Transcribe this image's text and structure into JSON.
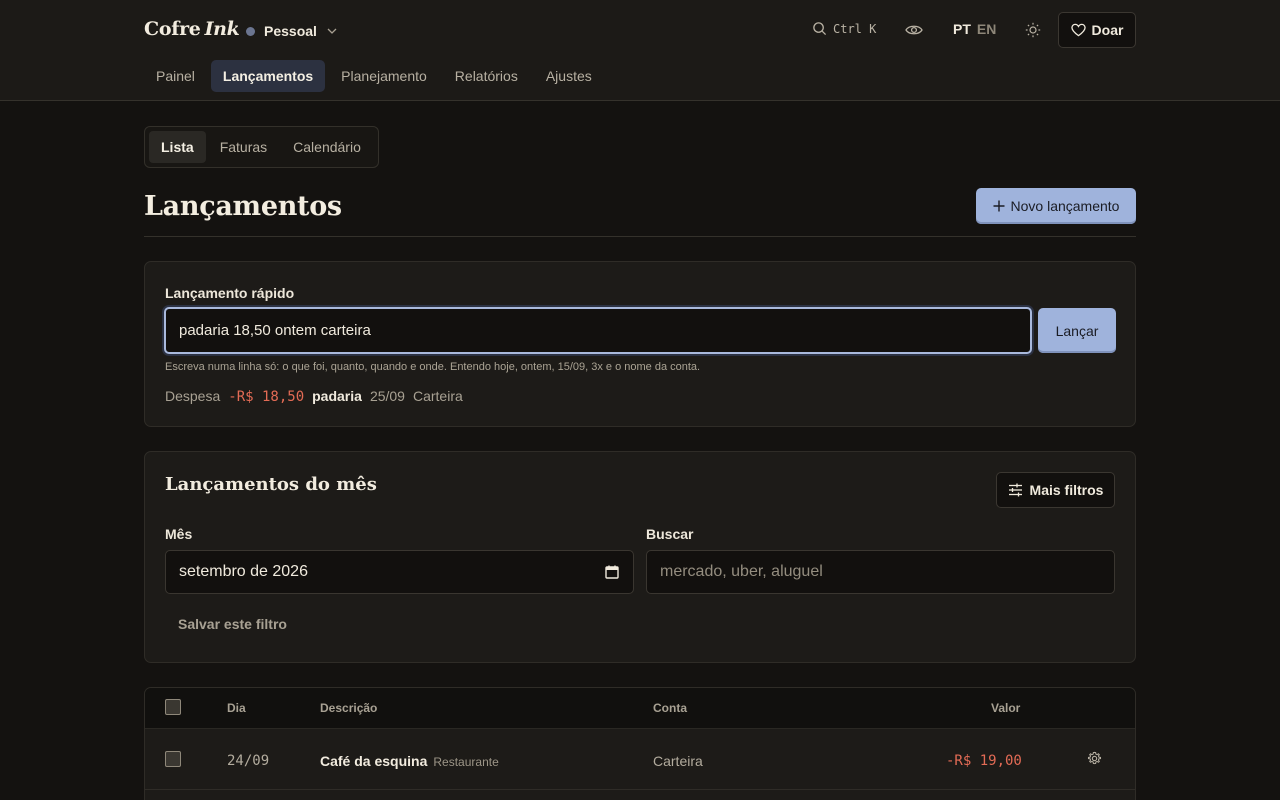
{
  "brand": {
    "name": "Cofre",
    "accent": "Ink"
  },
  "profile": {
    "name": "Pessoal"
  },
  "header": {
    "search_shortcut": "Ctrl K",
    "lang_active": "PT",
    "lang_other": "EN",
    "donate_label": "Doar"
  },
  "nav": {
    "items": [
      "Painel",
      "Lançamentos",
      "Planejamento",
      "Relatórios",
      "Ajustes"
    ],
    "active": "Lançamentos"
  },
  "subtabs": {
    "items": [
      "Lista",
      "Faturas",
      "Calendário"
    ],
    "active": "Lista"
  },
  "page": {
    "title": "Lançamentos",
    "new_button": "Novo lançamento"
  },
  "quick_entry": {
    "label": "Lançamento rápido",
    "value": "padaria 18,50 ontem carteira",
    "button": "Lançar",
    "help": "Escreva numa linha só: o que foi, quanto, quando e onde. Entendo hoje, ontem, 15/09, 3x e o nome da conta.",
    "preview": {
      "type": "Despesa",
      "amount": "-R$ 18,50",
      "description": "padaria",
      "date": "25/09",
      "account": "Carteira"
    }
  },
  "filters": {
    "title": "Lançamentos do mês",
    "more_button": "Mais filtros",
    "month_label": "Mês",
    "month_value": "setembro de 2026",
    "search_label": "Buscar",
    "search_placeholder": "mercado, uber, aluguel",
    "save_label": "Salvar este filtro"
  },
  "table": {
    "columns": {
      "day": "Dia",
      "description": "Descrição",
      "account": "Conta",
      "value": "Valor"
    },
    "rows": [
      {
        "day": "24/09",
        "description": "Café da esquina",
        "category": "Restaurante",
        "account": "Carteira",
        "value": "-R$ 19,00"
      }
    ]
  },
  "colors": {
    "background": "#141210",
    "accent": "#9fb3dc",
    "negative": "#e36b55"
  }
}
